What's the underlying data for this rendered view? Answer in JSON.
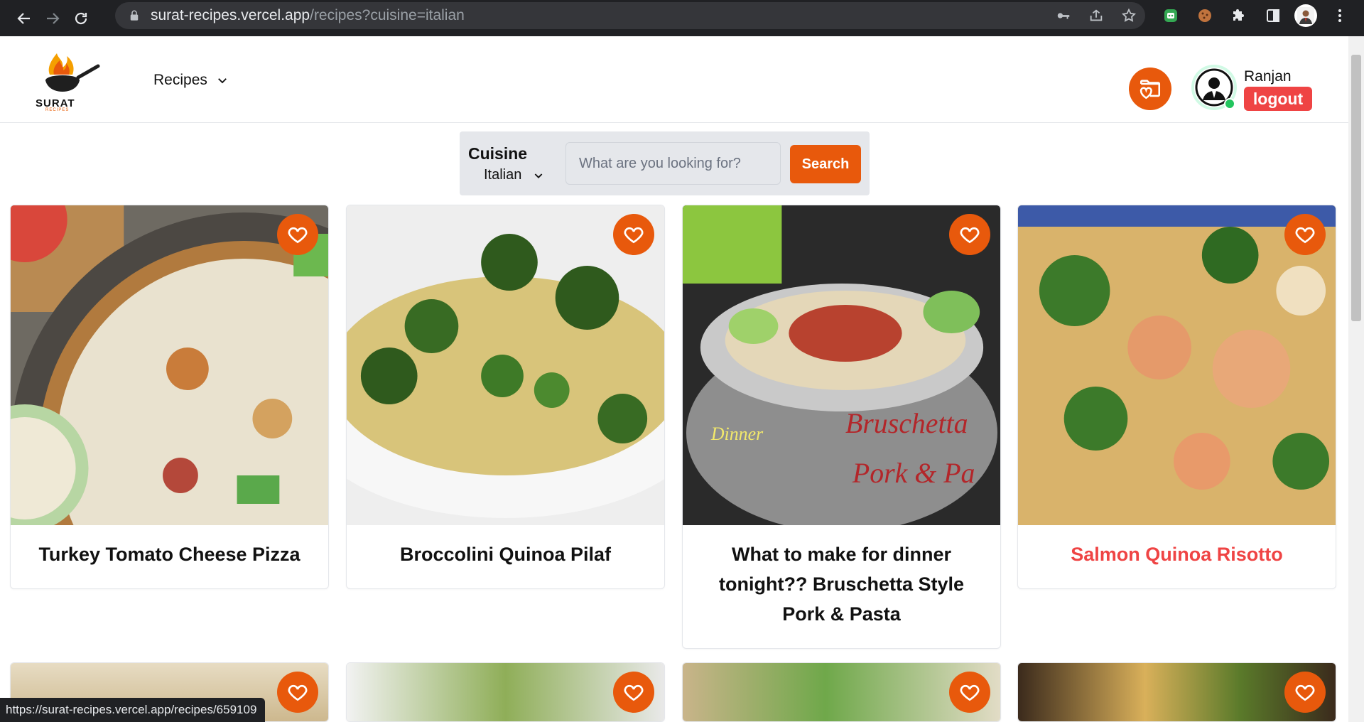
{
  "browser": {
    "url_host": "surat-recipes.vercel.app",
    "url_path": "/recipes?cuisine=italian",
    "status_url": "https://surat-recipes.vercel.app/recipes/659109"
  },
  "header": {
    "logo_text": "SURAT",
    "logo_sub": "RECIPES",
    "nav_recipes": "Recipes",
    "username": "Ranjan",
    "logout_label": "logout"
  },
  "search": {
    "cuisine_label": "Cuisine",
    "cuisine_value": "Italian",
    "placeholder": "What are you looking for?",
    "button_label": "Search"
  },
  "recipes": [
    {
      "title": "Turkey Tomato Cheese Pizza"
    },
    {
      "title": "Broccolini Quinoa Pilaf"
    },
    {
      "title": "What to make for dinner tonight?? Bruschetta Style Pork & Pasta"
    },
    {
      "title": "Salmon Quinoa Risotto"
    }
  ],
  "colors": {
    "accent": "#e8590c",
    "logout": "#ef4444",
    "hover_title": "#ef4444",
    "online": "#22c55e"
  }
}
